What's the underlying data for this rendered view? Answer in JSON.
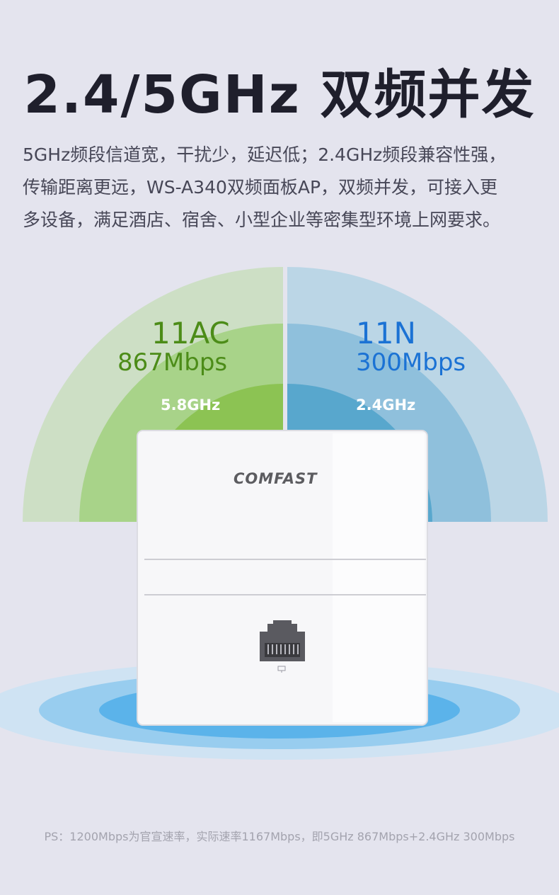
{
  "headline": "2.4/5GHz 双频并发",
  "description": {
    "lines": [
      "5GHz频段信道宽，干扰少，延迟低；2.4GHz频段兼容性强，",
      "传输距离更远，WS-A340双频面板AP，双频并发，可接入更",
      "多设备，满足酒店、宿舍、小型企业等密集型环境上网要求。"
    ]
  },
  "bands": {
    "left": {
      "standard": "11AC",
      "speed": "867Mbps",
      "frequency": "5.8GHz",
      "color": "#4c8c18"
    },
    "right": {
      "standard": "11N",
      "speed": "300Mbps",
      "frequency": "2.4GHz",
      "color": "#1b72d4"
    }
  },
  "device": {
    "brand": "COMFAST",
    "port_icon": "ethernet-port-icon"
  },
  "footnote": "PS：1200Mbps为官宣速率，实际速率1167Mbps，即5GHz 867Mbps+2.4GHz 300Mbps"
}
